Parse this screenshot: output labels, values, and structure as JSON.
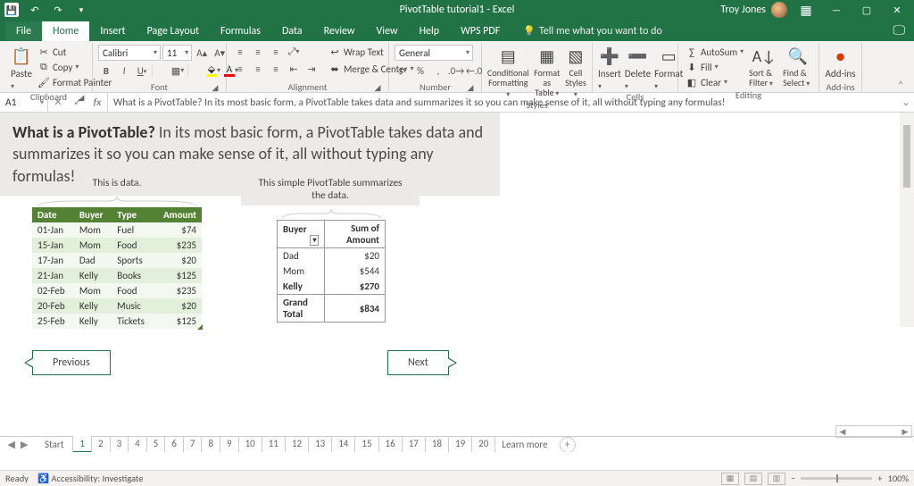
{
  "titlebar": {
    "doc": "PivotTable tutorial1  -  Excel",
    "user": "Troy Jones"
  },
  "tabs": {
    "file": "File",
    "home": "Home",
    "insert": "Insert",
    "page": "Page Layout",
    "formulas": "Formulas",
    "data": "Data",
    "review": "Review",
    "view": "View",
    "help": "Help",
    "wps": "WPS PDF",
    "tell": "Tell me what you want to do"
  },
  "ribbon": {
    "clipboard": {
      "paste": "Paste",
      "cut": "Cut",
      "copy": "Copy",
      "fmt": "Format Painter",
      "label": "Clipboard"
    },
    "font": {
      "name": "Calibri",
      "size": "11",
      "label": "Font"
    },
    "alignment": {
      "wrap": "Wrap Text",
      "merge": "Merge & Center",
      "label": "Alignment"
    },
    "number": {
      "fmt": "General",
      "label": "Number"
    },
    "styles": {
      "cond": "Conditional Formatting",
      "table": "Format as Table",
      "cell": "Cell Styles",
      "label": "Styles"
    },
    "cells": {
      "insert": "Insert",
      "delete": "Delete",
      "format": "Format",
      "label": "Cells"
    },
    "editing": {
      "sum": "AutoSum",
      "fill": "Fill",
      "clear": "Clear",
      "sort": "Sort & Filter",
      "find": "Find & Select",
      "label": "Editing"
    },
    "addins": {
      "label": "Add-ins",
      "btn": "Add-ins"
    }
  },
  "fbar": {
    "cell": "A1",
    "text": "What is a PivotTable? In its most basic form, a PivotTable takes data and summarizes it so you can make sense of it, all without typing any formulas!"
  },
  "page": {
    "heading_strong": "What is a PivotTable?",
    "heading_rest": " In its most basic form, a PivotTable takes data and summarizes it so you can make sense of it, all without typing any formulas!",
    "labelA": "This is data.",
    "labelB": "This simple PivotTable summarizes the data.",
    "prev": "Previous",
    "next": "Next",
    "tableA": {
      "headers": [
        "Date",
        "Buyer",
        "Type",
        "Amount"
      ],
      "rows": [
        [
          "01-Jan",
          "Mom",
          "Fuel",
          "$74"
        ],
        [
          "15-Jan",
          "Mom",
          "Food",
          "$235"
        ],
        [
          "17-Jan",
          "Dad",
          "Sports",
          "$20"
        ],
        [
          "21-Jan",
          "Kelly",
          "Books",
          "$125"
        ],
        [
          "02-Feb",
          "Mom",
          "Food",
          "$235"
        ],
        [
          "20-Feb",
          "Kelly",
          "Music",
          "$20"
        ],
        [
          "25-Feb",
          "Kelly",
          "Tickets",
          "$125"
        ]
      ]
    },
    "tableB": {
      "h1": "Buyer",
      "h2": "Sum of Amount",
      "rows": [
        [
          "Dad",
          "$20"
        ],
        [
          "Mom",
          "$544"
        ],
        [
          "Kelly",
          "$270"
        ]
      ],
      "total_l": "Grand Total",
      "total_v": "$834"
    }
  },
  "sheets": {
    "start": "Start",
    "nums": [
      "1",
      "2",
      "3",
      "4",
      "5",
      "6",
      "7",
      "8",
      "9",
      "10",
      "11",
      "12",
      "13",
      "14",
      "15",
      "16",
      "17",
      "18",
      "19",
      "20"
    ],
    "learn": "Learn more"
  },
  "status": {
    "ready": "Ready",
    "acc": "Accessibility: Investigate",
    "zoom": "100%"
  }
}
